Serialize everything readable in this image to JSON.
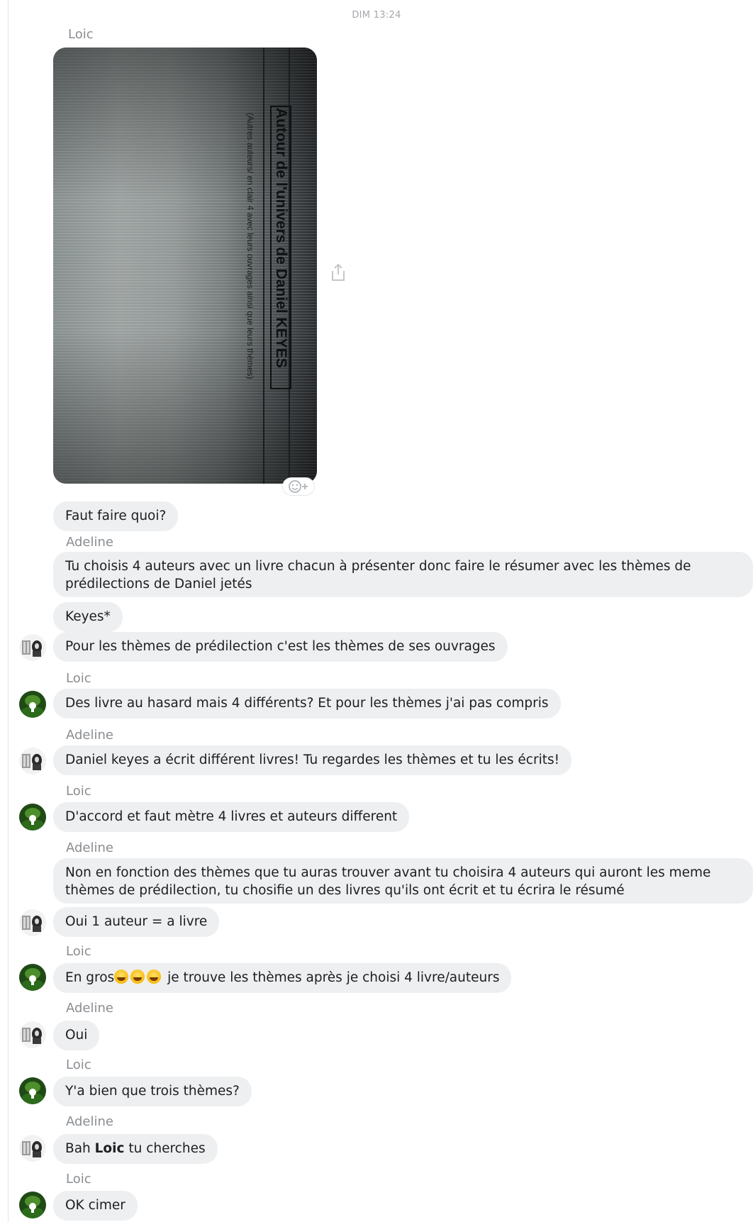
{
  "timestamp": "DIM 13:24",
  "photo": {
    "title": "Autour de l'univers de Daniel KEYES",
    "subtitle": "(Autres auteurs/ en clair 4 avec leurs ouvrages ainsi que leurs thèmes)"
  },
  "icons": {
    "share": "share-icon",
    "reaction": "add-reaction-icon",
    "avatar_adeline": "avatar-adeline",
    "avatar_loic": "avatar-loic"
  },
  "messages": [
    {
      "sender": "Loic",
      "text": "Faut faire quoi?"
    },
    {
      "sender": "Adeline",
      "text": "Tu choisis 4 auteurs avec un livre chacun à présenter donc faire le résumer avec les thèmes de prédilections de Daniel jetés"
    },
    {
      "sender": "Adeline",
      "text": "Keyes*"
    },
    {
      "sender": "Adeline",
      "text": "Pour les thèmes de prédilection c'est les thèmes de ses ouvrages"
    },
    {
      "sender": "Loic",
      "text": "Des livre au hasard mais 4 différents? Et pour les thèmes j'ai pas compris"
    },
    {
      "sender": "Adeline",
      "text": "Daniel keyes a écrit différent livres! Tu regardes les thèmes et tu les écrits!"
    },
    {
      "sender": "Loic",
      "text": "D'accord et faut mètre 4 livres et auteurs different"
    },
    {
      "sender": "Adeline",
      "text": "Non en fonction des thèmes que tu auras trouver avant tu choisira 4 auteurs qui auront les meme thèmes de prédilection, tu chosifie un des livres qu'ils ont écrit et tu écrira le résumé"
    },
    {
      "sender": "Adeline",
      "text": "Oui 1 auteur = a livre"
    },
    {
      "sender": "Loic",
      "text_before": "En gros",
      "text_after": " je trouve les thèmes après je choisi 4 livre/auteurs",
      "emoji_count": 3,
      "emoji": "laughing-emoji"
    },
    {
      "sender": "Adeline",
      "text": "Oui"
    },
    {
      "sender": "Loic",
      "text": "Y'a bien que trois thèmes?"
    },
    {
      "sender": "Adeline",
      "text_before": "Bah ",
      "mention": "Loic",
      "text_after": " tu cherches"
    },
    {
      "sender": "Loic",
      "text": "OK cimer"
    }
  ]
}
